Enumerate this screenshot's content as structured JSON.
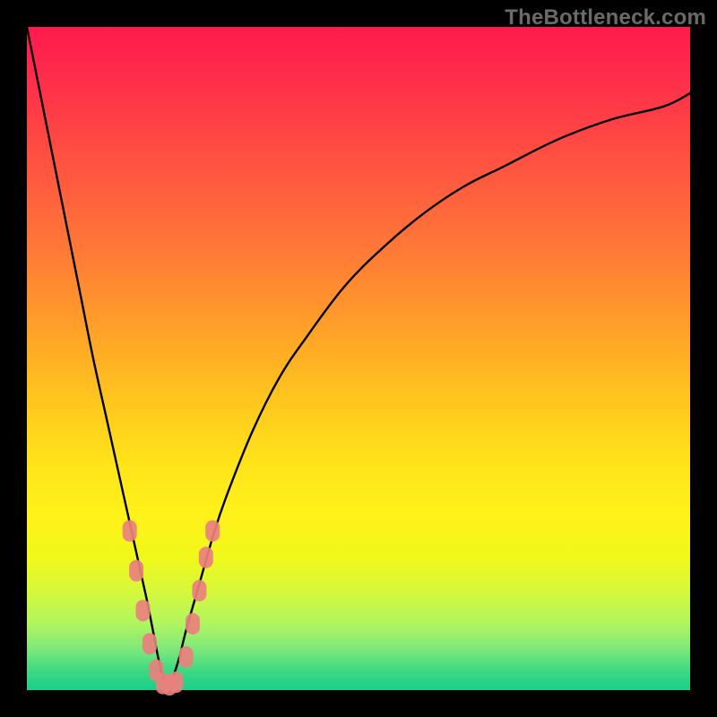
{
  "watermark": {
    "text": "TheBottleneck.com"
  },
  "colors": {
    "frame": "#000000",
    "curve_stroke": "#000000",
    "marker_fill": "#e9807e",
    "marker_stroke": "#e9807e"
  },
  "chart_data": {
    "type": "line",
    "title": "",
    "xlabel": "",
    "ylabel": "",
    "xlim": [
      0,
      100
    ],
    "ylim": [
      0,
      100
    ],
    "grid": false,
    "legend": false,
    "series": [
      {
        "name": "bottleneck-curve",
        "x_min_at": 21,
        "x": [
          0,
          2,
          4,
          6,
          8,
          10,
          12,
          14,
          16,
          18,
          19,
          20,
          21,
          22,
          23,
          24,
          26,
          28,
          30,
          34,
          38,
          42,
          48,
          54,
          60,
          66,
          72,
          80,
          88,
          96,
          100
        ],
        "y": [
          100,
          90,
          80,
          70,
          60,
          50,
          41,
          32,
          23,
          14,
          9,
          4,
          1,
          2,
          5,
          9,
          16,
          23,
          29,
          39,
          47,
          53,
          61,
          67,
          72,
          76,
          79,
          83,
          86,
          88,
          90
        ]
      }
    ],
    "markers": [
      {
        "x": 15.5,
        "y": 24
      },
      {
        "x": 16.5,
        "y": 18
      },
      {
        "x": 17.5,
        "y": 12
      },
      {
        "x": 18.5,
        "y": 7
      },
      {
        "x": 19.5,
        "y": 3
      },
      {
        "x": 20.5,
        "y": 1
      },
      {
        "x": 21.5,
        "y": 0.8
      },
      {
        "x": 22.5,
        "y": 1.2
      },
      {
        "x": 24.0,
        "y": 5
      },
      {
        "x": 25.0,
        "y": 10
      },
      {
        "x": 26.0,
        "y": 15
      },
      {
        "x": 27.0,
        "y": 20
      },
      {
        "x": 28.0,
        "y": 24
      }
    ]
  }
}
